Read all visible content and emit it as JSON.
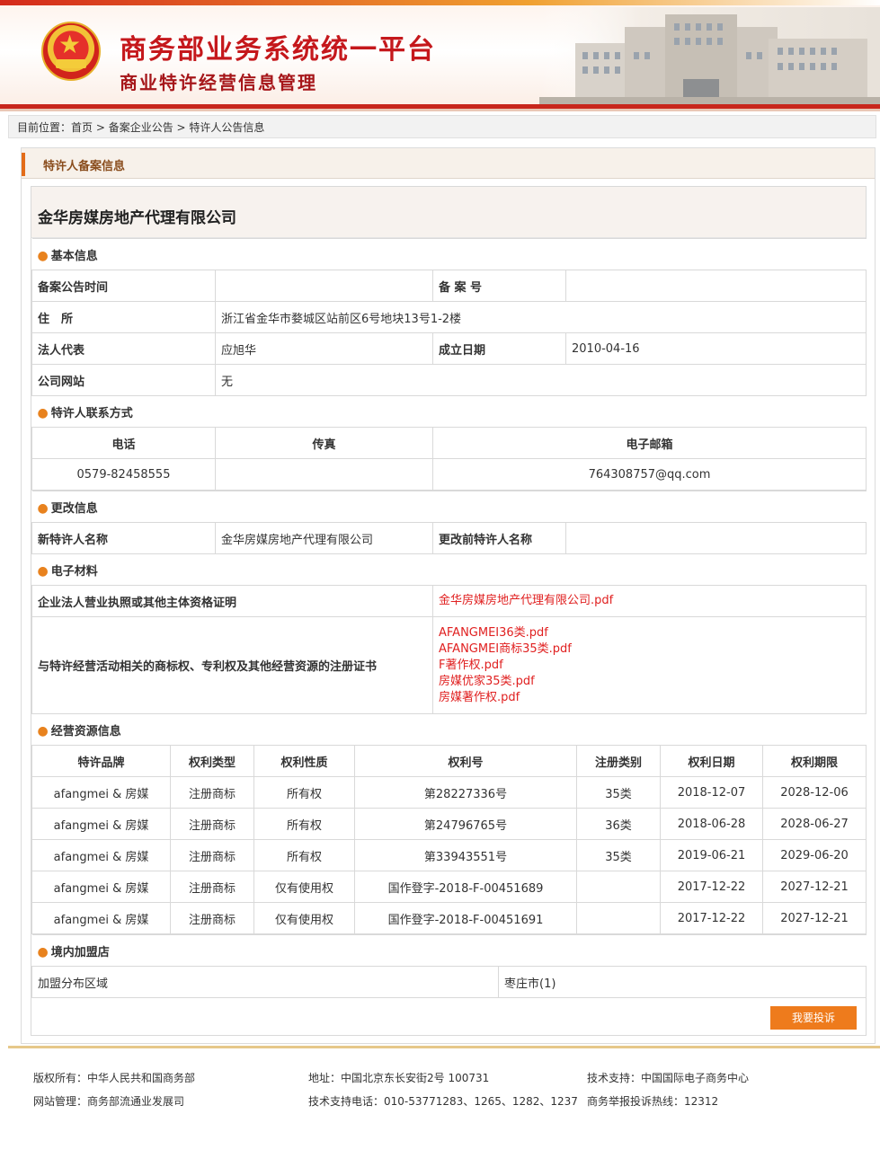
{
  "header": {
    "title": "商务部业务系统统一平台",
    "subtitle": "商业特许经营信息管理"
  },
  "breadcrumb": {
    "prefix": "目前位置：",
    "home": "首页",
    "sep1": " > ",
    "level2": "备案企业公告",
    "sep2": " > ",
    "current": "特许人公告信息"
  },
  "panel": {
    "title": "特许人备案信息"
  },
  "company_name": "金华房媒房地产代理有限公司",
  "basic": {
    "section": "基本信息",
    "announce_time_label": "备案公告时间",
    "announce_time_value": "",
    "record_no_label": "备 案 号",
    "record_no_value": "",
    "address_label": "住　所",
    "address_value": "浙江省金华市婺城区站前区6号地块13号1-2楼",
    "legal_rep_label": "法人代表",
    "legal_rep_value": "应旭华",
    "founded_label": "成立日期",
    "founded_value": "2010-04-16",
    "website_label": "公司网站",
    "website_value": "无"
  },
  "contact": {
    "section": "特许人联系方式",
    "phone_label": "电话",
    "fax_label": "传真",
    "email_label": "电子邮箱",
    "phone_value": "0579-82458555",
    "fax_value": "",
    "email_value": "764308757@qq.com"
  },
  "change": {
    "section": "更改信息",
    "new_name_label": "新特许人名称",
    "new_name_value": "金华房媒房地产代理有限公司",
    "old_name_label": "更改前特许人名称",
    "old_name_value": ""
  },
  "materials": {
    "section": "电子材料",
    "license_label": "企业法人营业执照或其他主体资格证明",
    "license_files": [
      "金华房媒房地产代理有限公司.pdf"
    ],
    "cert_label": "与特许经营活动相关的商标权、专利权及其他经营资源的注册证书",
    "cert_files": [
      "AFANGMEI36类.pdf",
      "AFANGMEI商标35类.pdf",
      "F著作权.pdf",
      "房媒优家35类.pdf",
      "房媒著作权.pdf"
    ]
  },
  "resources": {
    "section": "经营资源信息",
    "headers": [
      "特许品牌",
      "权利类型",
      "权利性质",
      "权利号",
      "注册类别",
      "权利日期",
      "权利期限"
    ],
    "rows": [
      [
        "afangmei & 房媒",
        "注册商标",
        "所有权",
        "第28227336号",
        "35类",
        "2018-12-07",
        "2028-12-06"
      ],
      [
        "afangmei & 房媒",
        "注册商标",
        "所有权",
        "第24796765号",
        "36类",
        "2018-06-28",
        "2028-06-27"
      ],
      [
        "afangmei & 房媒",
        "注册商标",
        "所有权",
        "第33943551号",
        "35类",
        "2019-06-21",
        "2029-06-20"
      ],
      [
        "afangmei & 房媒",
        "注册商标",
        "仅有使用权",
        "国作登字-2018-F-00451689",
        "",
        "2017-12-22",
        "2027-12-21"
      ],
      [
        "afangmei & 房媒",
        "注册商标",
        "仅有使用权",
        "国作登字-2018-F-00451691",
        "",
        "2017-12-22",
        "2027-12-21"
      ]
    ]
  },
  "stores": {
    "section": "境内加盟店",
    "area_label": "加盟分布区域",
    "area_value": "枣庄市(1)"
  },
  "complain_button": "我要投诉",
  "footer": {
    "copyright": "版权所有：中华人民共和国商务部",
    "manager": "网站管理：商务部流通业发展司",
    "address": "地址：中国北京东长安街2号 100731",
    "tech_phone": "技术支持电话：010-53771283、1265、1282、1237",
    "tech_support": "技术支持：中国国际电子商务中心",
    "hotline": "商务举报投诉热线：12312"
  },
  "colors": {
    "brand_red": "#c5181c",
    "accent_orange": "#ee7b1c",
    "link_red": "#e02020"
  }
}
